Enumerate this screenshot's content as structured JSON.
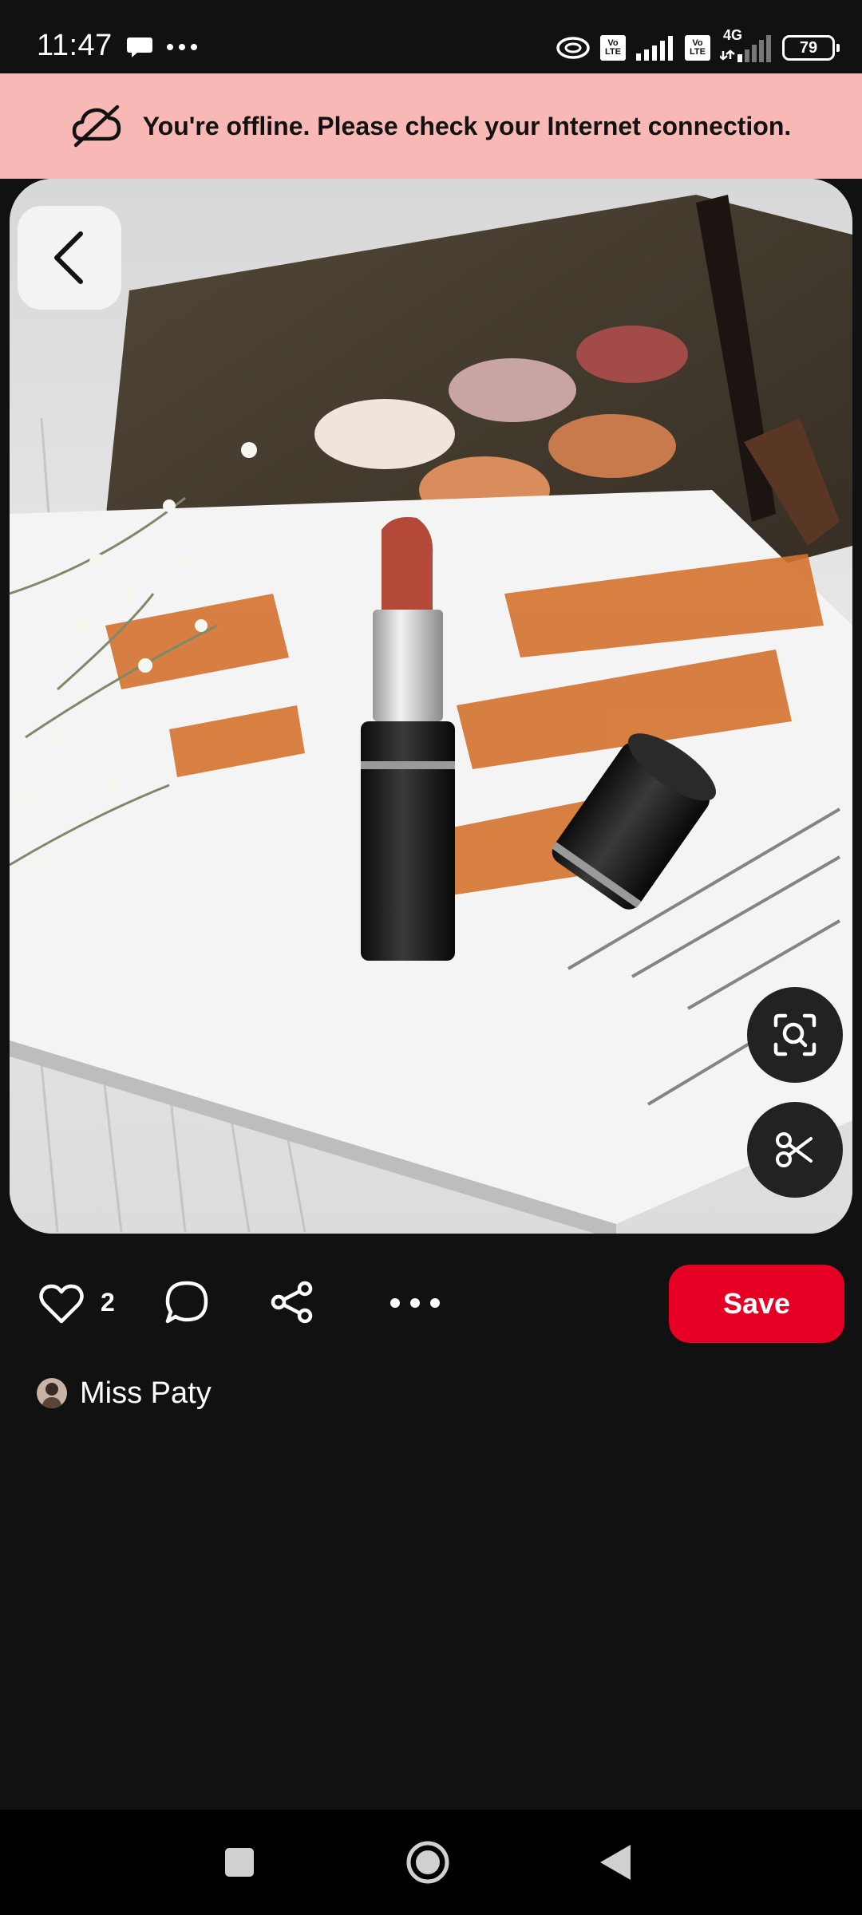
{
  "status_bar": {
    "time": "11:47",
    "lte_1_top": "Vo",
    "lte_1_bottom": "LTE",
    "lte_2_top": "Vo",
    "lte_2_bottom": "LTE",
    "network": "4G",
    "battery": "79"
  },
  "banner": {
    "message": "You're offline. Please check your Internet connection.",
    "icon": "cloud-off-icon",
    "background": "#f8b9b6"
  },
  "actions": {
    "like_count": "2",
    "save_label": "Save",
    "save_color": "#e60023"
  },
  "creator": {
    "name": "Miss Paty"
  }
}
